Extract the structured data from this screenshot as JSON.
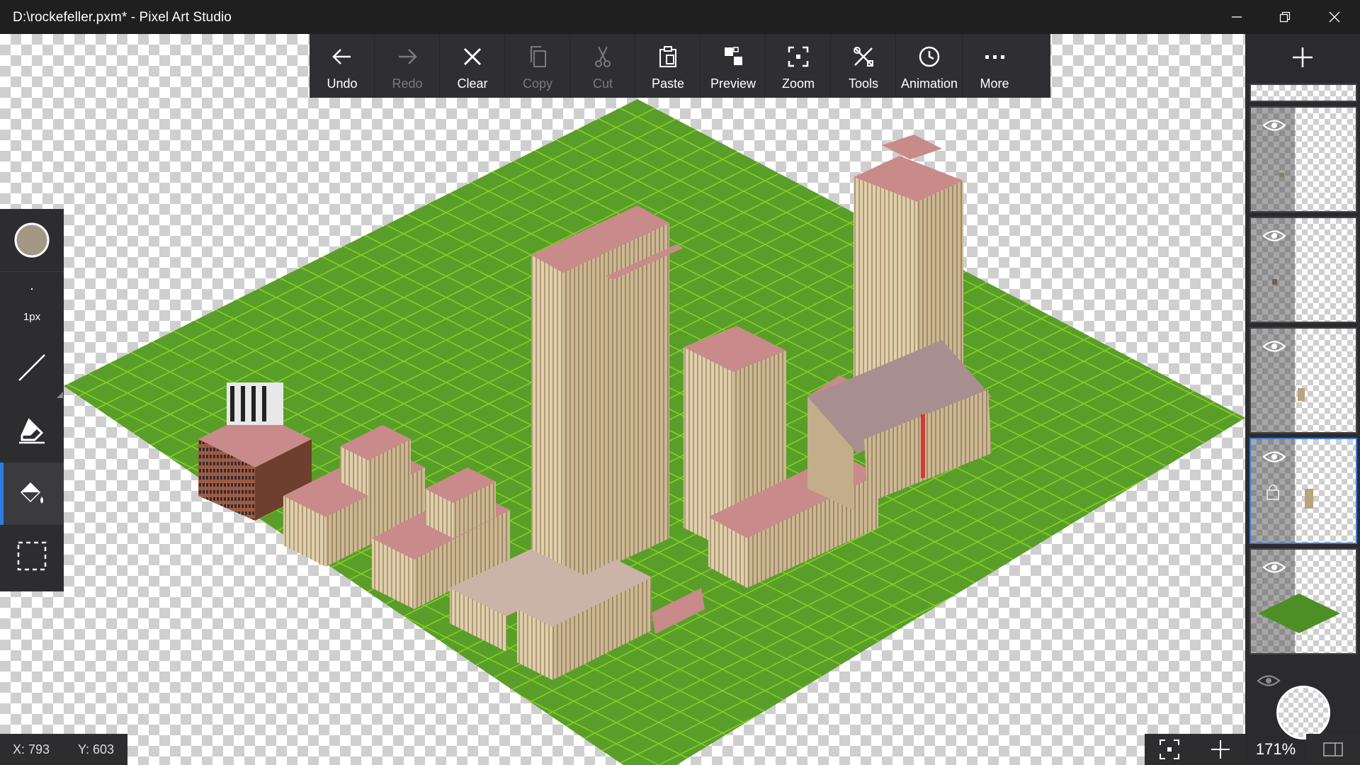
{
  "window": {
    "title": "D:\\rockefeller.pxm* - Pixel Art Studio",
    "controls": [
      "minimize-icon",
      "restore-icon",
      "close-icon"
    ]
  },
  "toolbar": {
    "buttons": [
      {
        "id": "undo",
        "label": "Undo",
        "icon": "arrow-left-icon",
        "enabled": true
      },
      {
        "id": "redo",
        "label": "Redo",
        "icon": "arrow-right-icon",
        "enabled": false
      },
      {
        "id": "clear",
        "label": "Clear",
        "icon": "x-icon",
        "enabled": true
      },
      {
        "id": "copy",
        "label": "Copy",
        "icon": "copy-icon",
        "enabled": false
      },
      {
        "id": "cut",
        "label": "Cut",
        "icon": "scissors-icon",
        "enabled": false
      },
      {
        "id": "paste",
        "label": "Paste",
        "icon": "clipboard-icon",
        "enabled": true
      },
      {
        "id": "preview",
        "label": "Preview",
        "icon": "preview-icon",
        "enabled": true
      },
      {
        "id": "zoom",
        "label": "Zoom",
        "icon": "zoom-frame-icon",
        "enabled": true
      },
      {
        "id": "tools",
        "label": "Tools",
        "icon": "tools-icon",
        "enabled": true
      },
      {
        "id": "animation",
        "label": "Animation",
        "icon": "clock-icon",
        "enabled": true
      },
      {
        "id": "more",
        "label": "More",
        "icon": "ellipsis-icon",
        "enabled": true
      }
    ]
  },
  "left_tools": {
    "color": "#a39785",
    "brush_size": "1px",
    "items": [
      "line-tool-icon",
      "eraser-icon",
      "fill-bucket-icon",
      "selection-icon"
    ],
    "active": "fill-bucket-icon"
  },
  "layers": {
    "add_icon": "plus-icon",
    "count_visible": 5,
    "active_index": 3,
    "footer_icon": "eye-icon"
  },
  "status": {
    "x": "X: 793",
    "y": "Y: 603"
  },
  "zoom": {
    "value": "171%"
  },
  "colors": {
    "grass": "#5a9e2a",
    "grass_line": "#7ac81f",
    "building": "#c9b48f",
    "roof": "#c98a8a"
  }
}
